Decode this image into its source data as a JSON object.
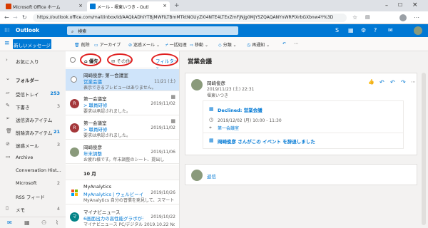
{
  "browser": {
    "tabs": [
      {
        "title": "Microsoft Office ホーム"
      },
      {
        "title": "メール - 堰東いつき - Outl"
      }
    ],
    "new_tab": "+",
    "url": "https://outlook.office.com/mail/inbox/id/AAQkADhiYTBjMWFiLTBmMTktNGUyZi04NTE4LTExZmFjNjg0MjY5ZQAQANYnWRPlXrbGXbnw4Y%3D"
  },
  "header": {
    "app_name": "Outlook",
    "search_placeholder": "検索"
  },
  "toolbar": {
    "new_message": "新しいメッセージ",
    "delete": "削除",
    "archive": "アーカイブ",
    "junk": "迷惑メール",
    "sweep": "一括処理",
    "move": "移動",
    "categorize": "分類",
    "snooze": "再通知"
  },
  "sidebar": {
    "favorites": "お気に入り",
    "folders": "フォルダー",
    "items": [
      {
        "label": "受信トレイ",
        "count": "253"
      },
      {
        "label": "下書き",
        "count": "3"
      },
      {
        "label": "送信済みアイテム",
        "count": ""
      },
      {
        "label": "削除済みアイテム",
        "count": "21"
      },
      {
        "label": "迷惑メール",
        "count": "3"
      },
      {
        "label": "Archive",
        "count": ""
      },
      {
        "label": "Conversation Hist...",
        "count": ""
      },
      {
        "label": "Microsoft",
        "count": "2"
      },
      {
        "label": "RSS フィード",
        "count": ""
      },
      {
        "label": "メモ",
        "count": "4"
      }
    ]
  },
  "list": {
    "tab_focused": "優先",
    "tab_other": "その他",
    "filter": "フィルター",
    "group_label": "10 月",
    "messages": [
      {
        "from": "岡崎俊彦; 第一会議室",
        "subject": "営業会議",
        "preview": "表示できるプレビューはありません。",
        "date": "11/21 (土)",
        "initial": ""
      },
      {
        "from": "第一会議室",
        "subject": "> 職員研修",
        "preview": "要求は承認されました。",
        "date": "2019/11/02",
        "initial": "R"
      },
      {
        "from": "第一会議室",
        "subject": "> 職員研修",
        "preview": "要求は承認されました。",
        "date": "2019/11/02",
        "initial": "R"
      },
      {
        "from": "岡崎俊彦",
        "subject": "年末調整",
        "preview": "お疲れ様です。年末調整のシート、提出し",
        "date": "2019/11/06",
        "initial": ""
      },
      {
        "from": "MyAnalytics",
        "subject": "MyAnalytics | ウェルビーイング エ...",
        "preview": "MyAnalytics 自分の習慣を発見して、スマートに働...",
        "date": "2019/10/26",
        "initial": ""
      },
      {
        "from": "マイナビニュース",
        "subject": "6画面出力の高性能グラボがチープ...",
        "preview": "マイナビニュース PC/デジタル 2019.10.22 No.1893",
        "date": "2019/10/22",
        "initial": "マ"
      }
    ]
  },
  "reading": {
    "subject": "営業会議",
    "sender": "岡崎俊彦",
    "sent_at": "2019/11/23 (土) 22:31",
    "to": "堰東いつき",
    "declined_title": "Declined: 営業会議",
    "meeting_time": "2019/12/02 (月) 10:00 - 11:30",
    "location": "第一会議室",
    "declined_note": "岡崎俊彦 さんがこの イベント を辞退しました",
    "reply": "返信"
  },
  "colors": {
    "accent": "#0078d4",
    "highlight": "#e02020"
  }
}
